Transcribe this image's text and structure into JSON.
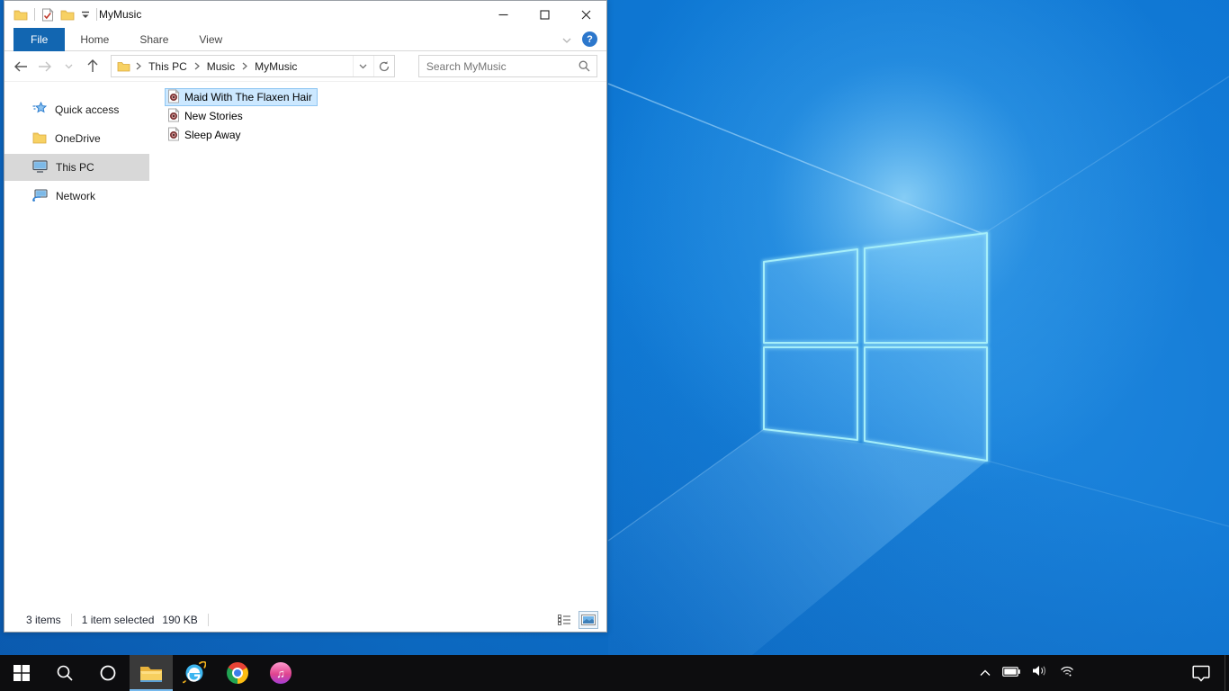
{
  "window": {
    "title": "MyMusic",
    "ribbon": {
      "tabs": [
        {
          "label": "File"
        },
        {
          "label": "Home"
        },
        {
          "label": "Share"
        },
        {
          "label": "View"
        }
      ],
      "help_label": "?"
    },
    "nav": {
      "breadcrumb": [
        "This PC",
        "Music",
        "MyMusic"
      ],
      "search_placeholder": "Search MyMusic"
    },
    "sidebar": [
      {
        "label": "Quick access",
        "icon": "quick-access-star"
      },
      {
        "label": "OneDrive",
        "icon": "folder"
      },
      {
        "label": "This PC",
        "icon": "monitor",
        "selected": true
      },
      {
        "label": "Network",
        "icon": "network"
      }
    ],
    "files": [
      {
        "name": "Maid With The Flaxen Hair",
        "icon": "audio-file",
        "selected": true
      },
      {
        "name": "New Stories",
        "icon": "audio-file",
        "selected": false
      },
      {
        "name": "Sleep Away",
        "icon": "audio-file",
        "selected": false
      }
    ],
    "statusbar": {
      "count": "3 items",
      "selected": "1 item selected",
      "size": "190 KB"
    }
  },
  "taskbar": {
    "buttons": [
      "start",
      "search",
      "cortana",
      "file-explorer",
      "internet-explorer",
      "chrome",
      "itunes"
    ],
    "active_button": "file-explorer",
    "itunes_glyph": "♫",
    "ie_glyph": "e",
    "tray_icons": [
      "tray-expand",
      "battery",
      "volume",
      "wifi",
      "action-center"
    ]
  },
  "colors": {
    "file_tab_blue": "#1266b1",
    "selection_fill": "#cce8ff",
    "selection_border": "#8fc6f2",
    "sidebar_selected": "#d8d8d8",
    "taskbar": "#0d0d0f",
    "taskbar_active_underline": "#76b9ed",
    "desktop_blue": "#0d6fca",
    "logo_edge_cyan": "#a5eef9"
  }
}
